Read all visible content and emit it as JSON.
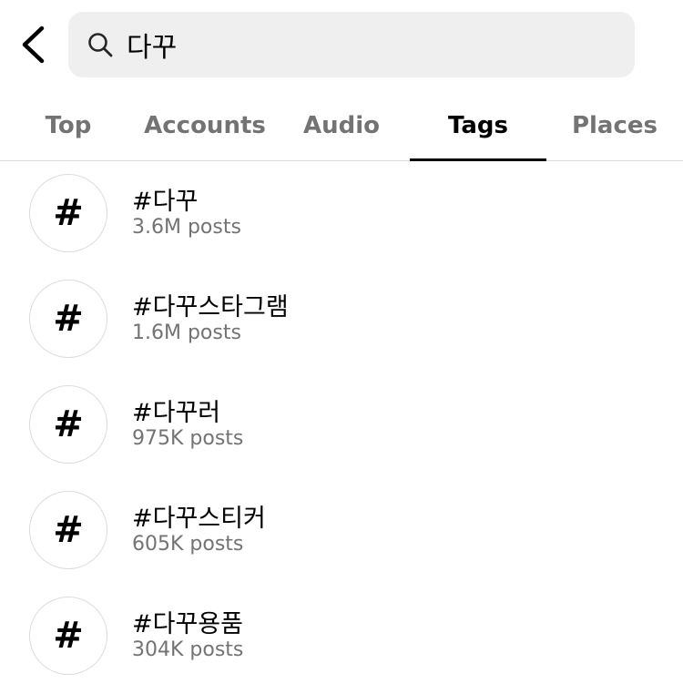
{
  "search": {
    "value": "다꾸",
    "icons": {
      "back": "chevron-left-icon",
      "search": "search-icon"
    }
  },
  "tabs": [
    {
      "label": "Top",
      "active": false
    },
    {
      "label": "Accounts",
      "active": false
    },
    {
      "label": "Audio",
      "active": false
    },
    {
      "label": "Tags",
      "active": true
    },
    {
      "label": "Places",
      "active": false
    }
  ],
  "results": [
    {
      "icon": "#",
      "name": "#다꾸",
      "count": "3.6M posts"
    },
    {
      "icon": "#",
      "name": "#다꾸스타그램",
      "count": "1.6M posts"
    },
    {
      "icon": "#",
      "name": "#다꾸러",
      "count": "975K posts"
    },
    {
      "icon": "#",
      "name": "#다꾸스티커",
      "count": "605K posts"
    },
    {
      "icon": "#",
      "name": "#다꾸용품",
      "count": "304K posts"
    }
  ],
  "colors": {
    "search_background": "#efefef",
    "secondary_text": "#737373",
    "divider": "#dbdbdb"
  }
}
